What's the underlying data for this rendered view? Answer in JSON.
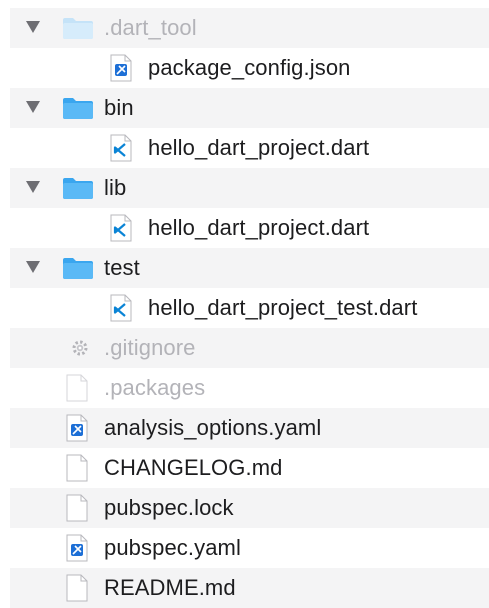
{
  "rows": [
    {
      "label": ".dart_tool",
      "kind": "folder",
      "expanded": true,
      "dimmed": true,
      "icon": "folder-icon"
    },
    {
      "label": "package_config.json",
      "kind": "file",
      "dimmed": false,
      "icon": "xcode-file-icon"
    },
    {
      "label": "bin",
      "kind": "folder",
      "expanded": true,
      "dimmed": false,
      "icon": "folder-icon"
    },
    {
      "label": "hello_dart_project.dart",
      "kind": "file",
      "dimmed": false,
      "icon": "vscode-file-icon"
    },
    {
      "label": "lib",
      "kind": "folder",
      "expanded": true,
      "dimmed": false,
      "icon": "folder-icon"
    },
    {
      "label": "hello_dart_project.dart",
      "kind": "file",
      "dimmed": false,
      "icon": "vscode-file-icon"
    },
    {
      "label": "test",
      "kind": "folder",
      "expanded": true,
      "dimmed": false,
      "icon": "folder-icon"
    },
    {
      "label": "hello_dart_project_test.dart",
      "kind": "file",
      "dimmed": false,
      "icon": "vscode-file-icon"
    },
    {
      "label": ".gitignore",
      "kind": "file",
      "dimmed": true,
      "icon": "gear-icon"
    },
    {
      "label": ".packages",
      "kind": "file",
      "dimmed": true,
      "icon": "blank-file-icon"
    },
    {
      "label": "analysis_options.yaml",
      "kind": "file",
      "dimmed": false,
      "icon": "xcode-file-icon"
    },
    {
      "label": "CHANGELOG.md",
      "kind": "file",
      "dimmed": false,
      "icon": "blank-file-icon"
    },
    {
      "label": "pubspec.lock",
      "kind": "file",
      "dimmed": false,
      "icon": "blank-file-icon"
    },
    {
      "label": "pubspec.yaml",
      "kind": "file",
      "dimmed": false,
      "icon": "xcode-file-icon"
    },
    {
      "label": "README.md",
      "kind": "file",
      "dimmed": false,
      "icon": "blank-file-icon"
    }
  ],
  "colors": {
    "folder": "#4fb3f5",
    "folder_dim": "#c5e3f8",
    "vscode_blue": "#0a84d6",
    "stripe": "#f4f4f5"
  }
}
